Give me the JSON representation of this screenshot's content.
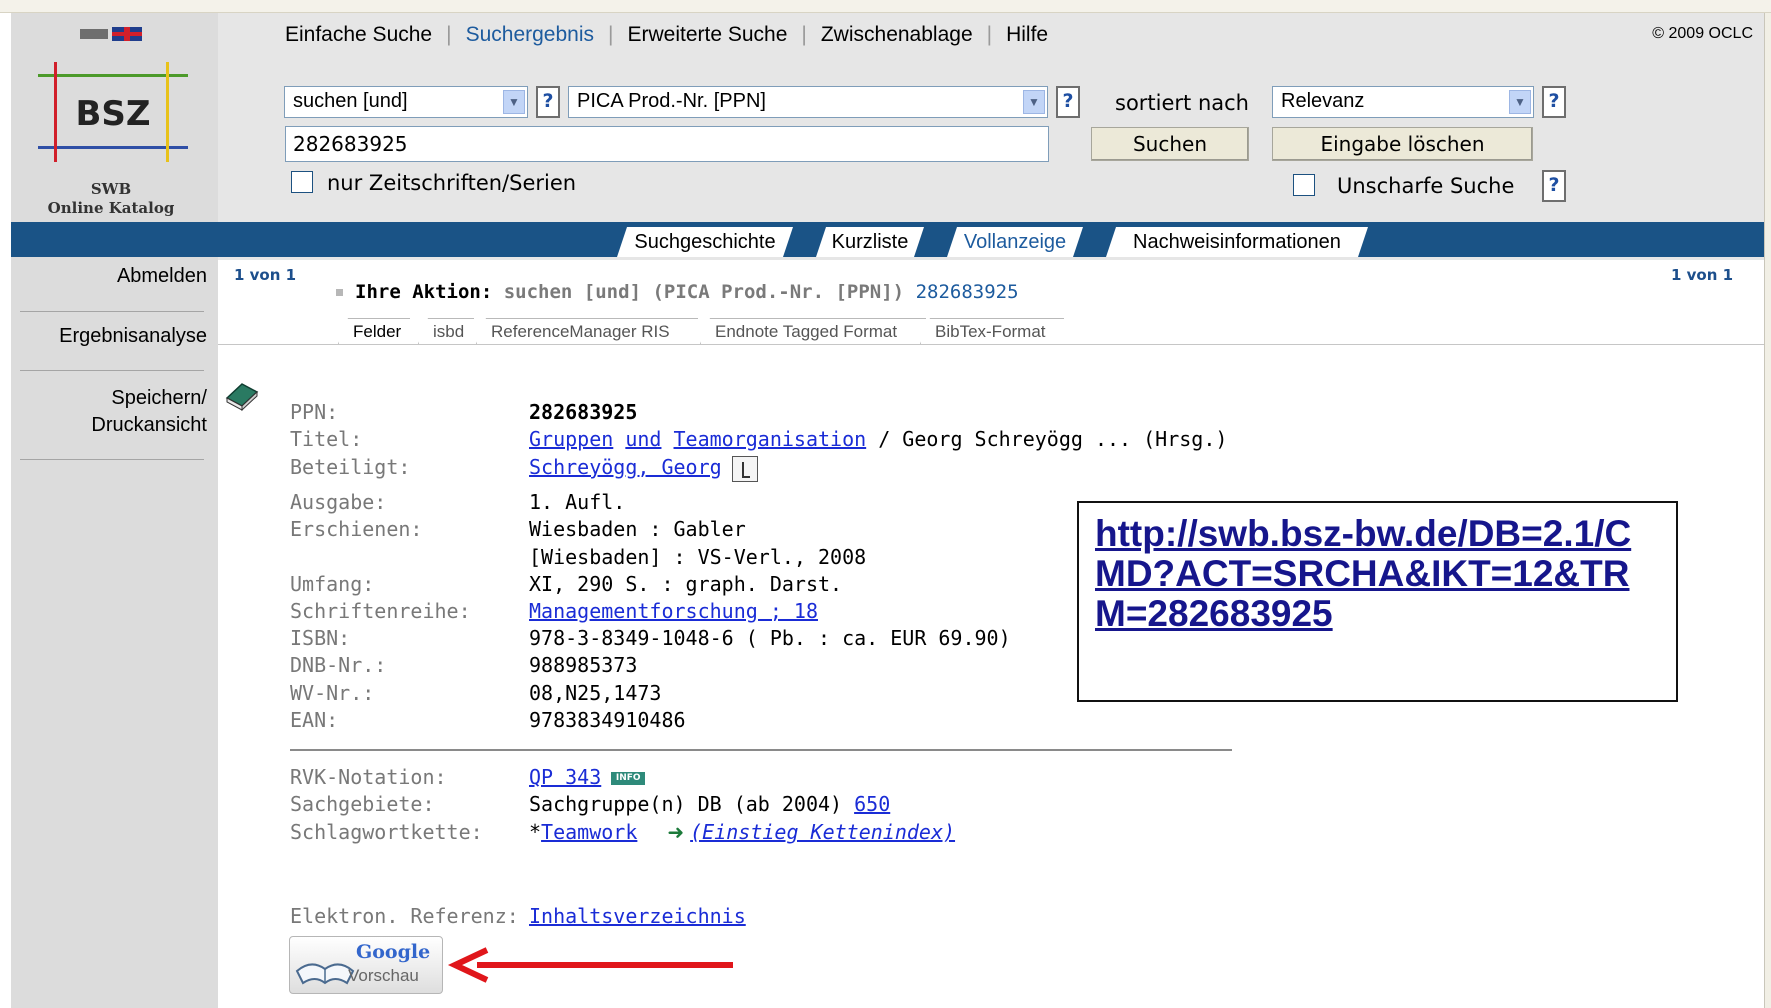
{
  "menu": {
    "items": [
      {
        "label": "Einfache Suche",
        "active": false
      },
      {
        "label": "Suchergebnis",
        "active": true
      },
      {
        "label": "Erweiterte Suche",
        "active": false
      },
      {
        "label": "Zwischenablage",
        "active": false
      },
      {
        "label": "Hilfe",
        "active": false
      }
    ],
    "copyright": "© 2009 OCLC",
    "language_icons": [
      "german-flag-icon",
      "uk-flag-icon"
    ]
  },
  "logo": {
    "text": "BSZ",
    "caption_line1": "SWB",
    "caption_line2": "Online Katalog"
  },
  "search": {
    "operator": "suchen [und]",
    "field": "PICA Prod.-Nr. [PPN]",
    "sort_label": "sortiert nach",
    "sort_value": "Relevanz",
    "query": "282683925",
    "search_button": "Suchen",
    "clear_button": "Eingabe löschen",
    "journals_only": "nur Zeitschriften/Serien",
    "fuzzy": "Unscharfe Suche",
    "help_label": "?"
  },
  "tabs": [
    {
      "label": "Suchgeschichte",
      "active": false
    },
    {
      "label": "Kurzliste",
      "active": false
    },
    {
      "label": "Vollanzeige",
      "active": true
    },
    {
      "label": "Nachweisinformationen",
      "active": false
    }
  ],
  "sidebar": {
    "logout": "Abmelden",
    "analysis": "Ergebnisanalyse",
    "save_line1": "Speichern/",
    "save_line2": "Druckansicht"
  },
  "result": {
    "pager_left": "1 von 1",
    "pager_right": "1 von 1",
    "action_label": "Ihre Aktion:",
    "action_text": "suchen [und] (PICA Prod.-Nr. [PPN])",
    "action_term": "282683925"
  },
  "formats": [
    {
      "label": "Felder",
      "active": true
    },
    {
      "label": "isbd",
      "active": false
    },
    {
      "label": "ReferenceManager RIS",
      "active": false
    },
    {
      "label": "Endnote Tagged Format",
      "active": false
    },
    {
      "label": "BibTex-Format",
      "active": false
    }
  ],
  "record": {
    "ppn_label": "PPN:",
    "ppn": "282683925",
    "title_label": "Titel:",
    "title_link1": "Gruppen",
    "title_link2": "und",
    "title_link3": "Teamorganisation",
    "title_rest": " / Georg Schreyögg ... (Hrsg.)",
    "contrib_label": "Beteiligt:",
    "contrib": "Schreyögg, Georg",
    "edition_label": "Ausgabe:",
    "edition": "1. Aufl.",
    "published_label": "Erschienen:",
    "published1": "Wiesbaden : Gabler",
    "published2": "[Wiesbaden] : VS-Verl., 2008",
    "extent_label": "Umfang:",
    "extent": "XI, 290 S. : graph. Darst.",
    "series_label": "Schriftenreihe:",
    "series": "Managementforschung ; 18",
    "isbn_label": "ISBN:",
    "isbn": "978-3-8349-1048-6 ( Pb. : ca. EUR 69.90)",
    "dnb_label": "DNB-Nr.:",
    "dnb": "988985373",
    "wv_label": "WV-Nr.:",
    "wv": "08,N25,1473",
    "ean_label": "EAN:",
    "ean": "9783834910486",
    "rvk_label": "RVK-Notation:",
    "rvk": "QP 343",
    "rvk_badge": "INFO",
    "subjects_label": "Sachgebiete:",
    "subjects": "Sachgruppe(n) DB (ab 2004) ",
    "subjects_link": "650",
    "keywords_label": "Schlagwortkette:",
    "keywords_prefix": "*",
    "keywords_link": "Teamwork",
    "keywords_index": "(Einstieg Kettenindex)",
    "eref_label": "Elektron. Referenz:",
    "eref_link": "Inhaltsverzeichnis"
  },
  "url_box": "http://swb.bsz-bw.de/DB=2.1/CMD?ACT=SRCHA&IKT=12&TRM=282683925",
  "google_preview": {
    "brand": "Google",
    "label": "Vorschau"
  },
  "colors": {
    "nav_bar": "#1a5386",
    "link": "#1a2cd6",
    "arrow": "#e0161b"
  }
}
